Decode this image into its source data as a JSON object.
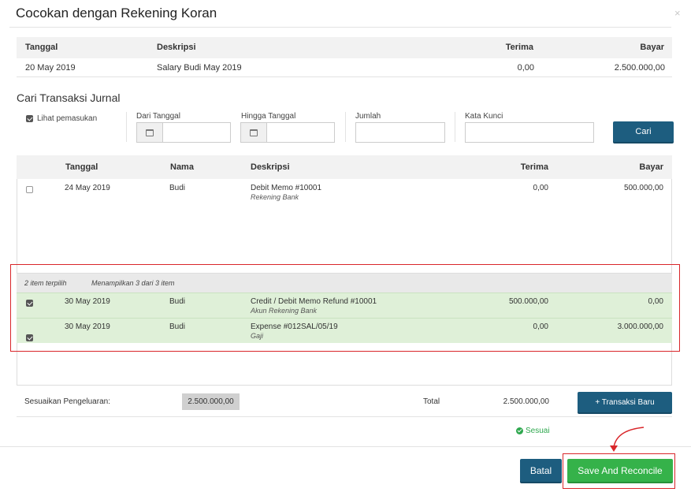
{
  "modal": {
    "title": "Cocokan dengan Rekening Koran",
    "close_glyph": "×"
  },
  "statement": {
    "columns": {
      "date": "Tanggal",
      "description": "Deskripsi",
      "received": "Terima",
      "paid": "Bayar"
    },
    "row": {
      "date": "20 May 2019",
      "description": "Salary Budi May 2019",
      "received": "0,00",
      "paid": "2.500.000,00"
    }
  },
  "search": {
    "title": "Cari Transaksi Jurnal",
    "show_income_label": "Lihat pemasukan",
    "show_income_checked": true,
    "from_date_label": "Dari Tanggal",
    "to_date_label": "Hingga Tanggal",
    "amount_label": "Jumlah",
    "keyword_label": "Kata Kunci",
    "search_button": "Cari"
  },
  "journal": {
    "columns": {
      "date": "Tanggal",
      "name": "Nama",
      "description": "Deskripsi",
      "received": "Terima",
      "paid": "Bayar"
    },
    "rows": [
      {
        "checked": false,
        "date": "24 May 2019",
        "name": "Budi",
        "description": "Debit Memo #10001",
        "sub": "Rekening Bank",
        "received": "0,00",
        "paid": "500.000,00"
      }
    ],
    "selection": {
      "count_text": "2 item terpilih",
      "showing_text": "Menampilkan 3 dari 3 item"
    },
    "selected_rows": [
      {
        "checked": true,
        "date": "30 May 2019",
        "name": "Budi",
        "description": "Credit / Debit Memo Refund #10001",
        "sub": "Akun Rekening Bank",
        "received": "500.000,00",
        "paid": "0,00"
      },
      {
        "checked": true,
        "date": "30 May 2019",
        "name": "Budi",
        "description": "Expense #012SAL/05/19",
        "sub": "Gaji",
        "received": "0,00",
        "paid": "3.000.000,00"
      }
    ]
  },
  "summary": {
    "adjust_label": "Sesuaikan Pengeluaran:",
    "adjust_value": "2.500.000,00",
    "total_label": "Total",
    "total_value": "2.500.000,00",
    "new_transaction_button": "+ Transaksi Baru",
    "match_status": "Sesuai"
  },
  "footer": {
    "cancel_button": "Batal",
    "save_button": "Save And Reconcile"
  },
  "colors": {
    "primary": "#1d5d7f",
    "success": "#35b24a",
    "highlight": "#d9262a",
    "selected_row": "#dff0d8"
  }
}
